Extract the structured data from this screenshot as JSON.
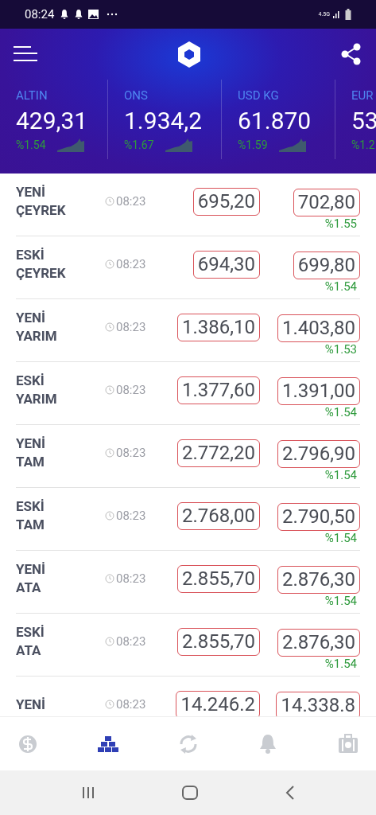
{
  "status_bar": {
    "time": "08:24",
    "network": "4.5G"
  },
  "tickers": [
    {
      "label": "ALTIN",
      "value": "429,31",
      "change": "%1.54",
      "sparkline": true
    },
    {
      "label": "ONS",
      "value": "1.934,2",
      "change": "%1.67",
      "sparkline": true
    },
    {
      "label": "USD KG",
      "value": "61.870",
      "change": "%1.59",
      "sparkline": true
    },
    {
      "label": "EUR",
      "value": "53",
      "change": "%1.2"
    }
  ],
  "rows": [
    {
      "name": [
        "YENİ",
        "ÇEYREK"
      ],
      "time": "08:23",
      "buy": "695,20",
      "sell": "702,80",
      "change": "%1.55"
    },
    {
      "name": [
        "ESKİ",
        "ÇEYREK"
      ],
      "time": "08:23",
      "buy": "694,30",
      "sell": "699,80",
      "change": "%1.54"
    },
    {
      "name": [
        "YENİ",
        "YARIM"
      ],
      "time": "08:23",
      "buy": "1.386,10",
      "sell": "1.403,80",
      "change": "%1.53"
    },
    {
      "name": [
        "ESKİ",
        "YARIM"
      ],
      "time": "08:23",
      "buy": "1.377,60",
      "sell": "1.391,00",
      "change": "%1.54"
    },
    {
      "name": [
        "YENİ",
        "TAM"
      ],
      "time": "08:23",
      "buy": "2.772,20",
      "sell": "2.796,90",
      "change": "%1.54"
    },
    {
      "name": [
        "ESKİ",
        "TAM"
      ],
      "time": "08:23",
      "buy": "2.768,00",
      "sell": "2.790,50",
      "change": "%1.54"
    },
    {
      "name": [
        "YENİ",
        "ATA"
      ],
      "time": "08:23",
      "buy": "2.855,70",
      "sell": "2.876,30",
      "change": "%1.54"
    },
    {
      "name": [
        "ESKİ",
        "ATA"
      ],
      "time": "08:23",
      "buy": "2.855,70",
      "sell": "2.876,30",
      "change": "%1.54"
    },
    {
      "name": [
        "YENİ"
      ],
      "time": "08:23",
      "buy": "14.246.2",
      "sell": "14.338.8"
    }
  ],
  "bottom_nav": [
    {
      "kind": "currency",
      "selected": false
    },
    {
      "kind": "gold",
      "selected": true
    },
    {
      "kind": "converter",
      "selected": false
    },
    {
      "kind": "alarm",
      "selected": false
    },
    {
      "kind": "portfolio",
      "selected": false
    }
  ]
}
